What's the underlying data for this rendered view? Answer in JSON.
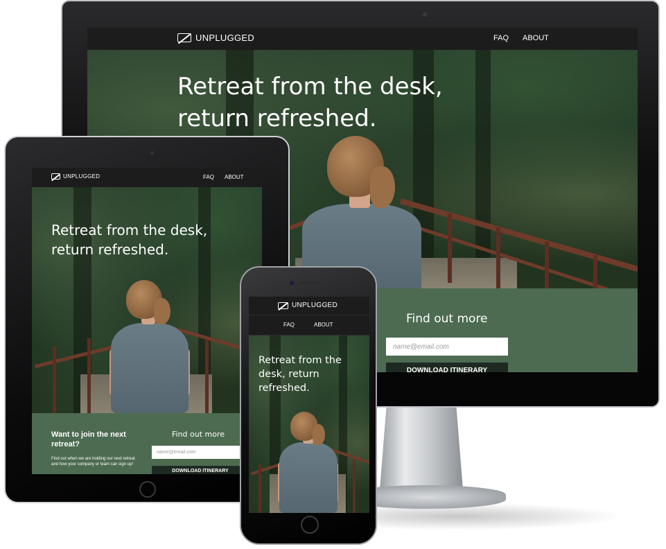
{
  "site": {
    "brand": "UNPLUGGED",
    "nav": {
      "faq": "FAQ",
      "about": "ABOUT"
    },
    "hero": {
      "headline_line1": "Retreat from the desk,",
      "headline_line2": "return refreshed.",
      "phone_line1": "Retreat from the",
      "phone_line2": "desk, return",
      "phone_line3": "refreshed."
    },
    "signup": {
      "title": "Find out more",
      "email_placeholder": "name@email.com",
      "button": "DOWNLOAD ITINERARY",
      "join_title_line1": "Want to join the next",
      "join_title_line2": "retreat?",
      "join_text_line1": "Find out when we are holding our next retreat",
      "join_text_line2": "and how your company or team can sign up!"
    }
  },
  "colors": {
    "nav_bg": "#1c1c1c",
    "panel_green": "#4d6b51",
    "button_dark": "#1e2a21",
    "bridge_rail": "#6e3b2a"
  },
  "icons": {
    "logo": "unplugged-battery-slash-icon"
  }
}
